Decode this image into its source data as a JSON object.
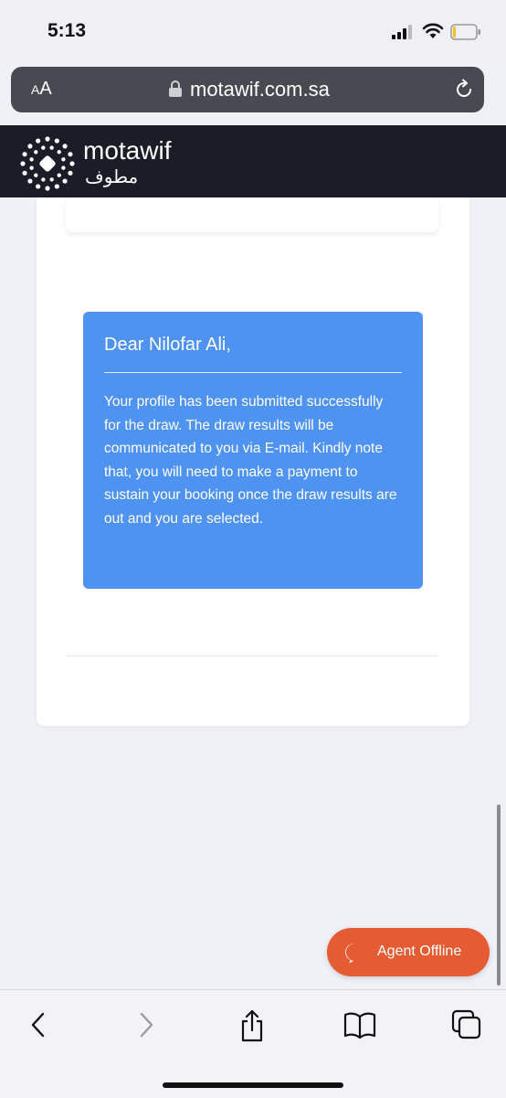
{
  "status_bar": {
    "time": "5:13"
  },
  "browser": {
    "reader_label_big": "A",
    "reader_label_small": "A",
    "url": "motawif.com.sa"
  },
  "site": {
    "logo_text": "motawif",
    "logo_arabic": "مطوف",
    "brand_color": "#1a1c27"
  },
  "message": {
    "greeting": "Dear Nilofar Ali,",
    "body": "Your profile has been submitted successfully for the draw. The draw results will be communicated to you via E-mail. Kindly note that, you will need to make a payment to sustain your booking once the draw results are out and you are selected.",
    "background_color": "#4f93f2"
  },
  "chat": {
    "label": "Agent Offline",
    "color": "#e55c33"
  },
  "toolbar": {
    "icons": [
      "back-icon",
      "forward-icon",
      "share-icon",
      "bookmarks-icon",
      "tabs-icon"
    ]
  }
}
